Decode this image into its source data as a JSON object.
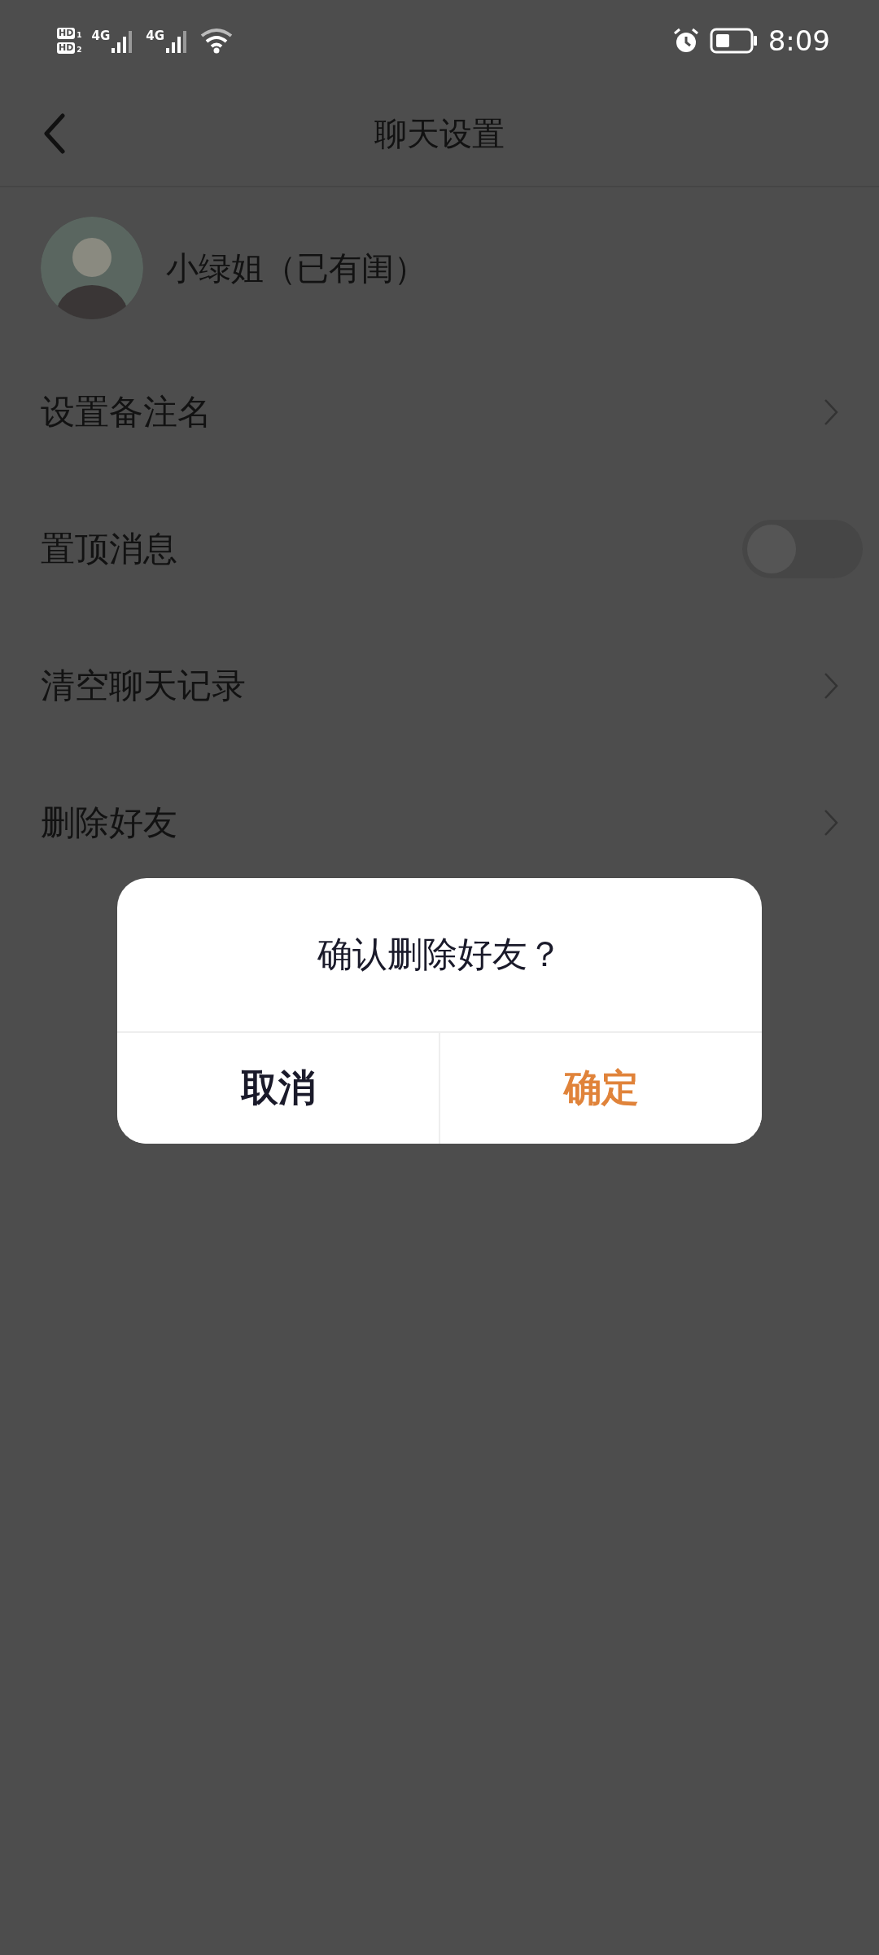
{
  "status_bar": {
    "sims": [
      {
        "label": "HD",
        "slot": "1"
      },
      {
        "label": "HD",
        "slot": "2"
      }
    ],
    "networks": [
      "4G",
      "4G"
    ],
    "time": "8:09"
  },
  "header": {
    "title": "聊天设置"
  },
  "profile": {
    "name": "小绿姐（已有闺）"
  },
  "settings": [
    {
      "kind": "link",
      "label": "设置备注名"
    },
    {
      "kind": "toggle",
      "label": "置顶消息",
      "on": false
    },
    {
      "kind": "link",
      "label": "清空聊天记录"
    },
    {
      "kind": "link",
      "label": "删除好友"
    }
  ],
  "dialog": {
    "message": "确认删除好友？",
    "buttons": [
      {
        "kind": "cancel",
        "label": "取消"
      },
      {
        "kind": "confirm",
        "label": "确定"
      }
    ]
  }
}
